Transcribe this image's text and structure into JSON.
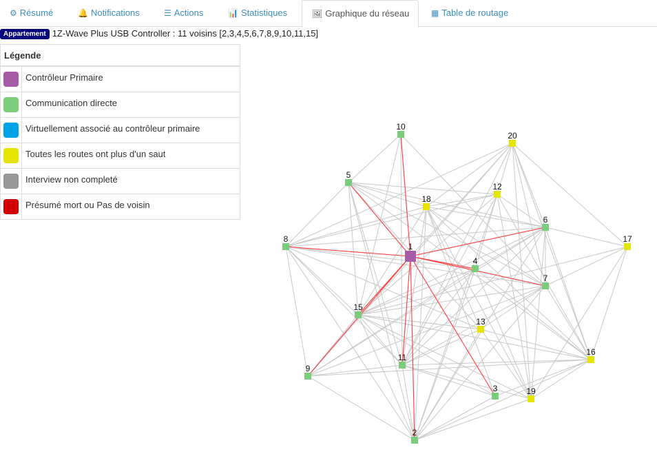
{
  "tabs": [
    {
      "label": "Résumé",
      "icon": "dashboard-icon",
      "glyph": "⚙"
    },
    {
      "label": "Notifications",
      "icon": "bell-icon",
      "glyph": "🔔"
    },
    {
      "label": "Actions",
      "icon": "sliders-icon",
      "glyph": "☰"
    },
    {
      "label": "Statistiques",
      "icon": "bar-chart-icon",
      "glyph": "📊"
    },
    {
      "label": "Graphique du réseau",
      "icon": "image-icon",
      "glyph": "🖼",
      "active": true
    },
    {
      "label": "Table de routage",
      "icon": "table-icon",
      "glyph": "▦"
    }
  ],
  "info": {
    "badge": "Appartement",
    "text": "1Z-Wave Plus USB Controller : 11 voisins [2,3,4,5,6,7,8,9,10,11,15]"
  },
  "legend": {
    "title": "Légende",
    "items": [
      {
        "label": "Contrôleur Primaire",
        "color": "#a65ba6"
      },
      {
        "label": "Communication directe",
        "color": "#7bcd7b"
      },
      {
        "label": "Virtuellement associé au contrôleur primaire",
        "color": "#00a2e8"
      },
      {
        "label": "Toutes les routes ont plus d'un saut",
        "color": "#e5e500"
      },
      {
        "label": "Interview non completé",
        "color": "#979797"
      },
      {
        "label": "Présumé mort ou Pas de voisin",
        "color": "#d20000"
      }
    ]
  },
  "graph": {
    "nodes": [
      {
        "id": "1",
        "type": 0
      },
      {
        "id": "2",
        "type": 1
      },
      {
        "id": "3",
        "type": 1
      },
      {
        "id": "4",
        "type": 1
      },
      {
        "id": "5",
        "type": 1
      },
      {
        "id": "6",
        "type": 1
      },
      {
        "id": "7",
        "type": 1
      },
      {
        "id": "8",
        "type": 1
      },
      {
        "id": "9",
        "type": 1
      },
      {
        "id": "10",
        "type": 1
      },
      {
        "id": "11",
        "type": 1
      },
      {
        "id": "12",
        "type": 3
      },
      {
        "id": "13",
        "type": 3
      },
      {
        "id": "15",
        "type": 1
      },
      {
        "id": "16",
        "type": 3
      },
      {
        "id": "17",
        "type": 3
      },
      {
        "id": "18",
        "type": 3
      },
      {
        "id": "19",
        "type": 3
      },
      {
        "id": "20",
        "type": 3
      }
    ],
    "controller_links": [
      "2",
      "3",
      "4",
      "5",
      "6",
      "7",
      "8",
      "9",
      "10",
      "11",
      "15"
    ],
    "links": [
      [
        "10",
        "5"
      ],
      [
        "10",
        "15"
      ],
      [
        "10",
        "7"
      ],
      [
        "10",
        "11"
      ],
      [
        "5",
        "8"
      ],
      [
        "5",
        "18"
      ],
      [
        "5",
        "12"
      ],
      [
        "5",
        "6"
      ],
      [
        "5",
        "7"
      ],
      [
        "5",
        "15"
      ],
      [
        "5",
        "11"
      ],
      [
        "5",
        "2"
      ],
      [
        "5",
        "16"
      ],
      [
        "5",
        "13"
      ],
      [
        "8",
        "18"
      ],
      [
        "8",
        "12"
      ],
      [
        "8",
        "20"
      ],
      [
        "8",
        "6"
      ],
      [
        "8",
        "7"
      ],
      [
        "8",
        "4"
      ],
      [
        "8",
        "15"
      ],
      [
        "8",
        "9"
      ],
      [
        "8",
        "11"
      ],
      [
        "8",
        "2"
      ],
      [
        "8",
        "13"
      ],
      [
        "18",
        "20"
      ],
      [
        "18",
        "6"
      ],
      [
        "18",
        "7"
      ],
      [
        "18",
        "16"
      ],
      [
        "18",
        "19"
      ],
      [
        "18",
        "13"
      ],
      [
        "18",
        "15"
      ],
      [
        "18",
        "11"
      ],
      [
        "18",
        "2"
      ],
      [
        "18",
        "3"
      ],
      [
        "18",
        "12"
      ],
      [
        "12",
        "15"
      ],
      [
        "12",
        "11"
      ],
      [
        "12",
        "16"
      ],
      [
        "12",
        "19"
      ],
      [
        "12",
        "2"
      ],
      [
        "12",
        "6"
      ],
      [
        "20",
        "15"
      ],
      [
        "20",
        "11"
      ],
      [
        "20",
        "6"
      ],
      [
        "20",
        "7"
      ],
      [
        "20",
        "16"
      ],
      [
        "20",
        "17"
      ],
      [
        "20",
        "19"
      ],
      [
        "20",
        "9"
      ],
      [
        "20",
        "4"
      ],
      [
        "6",
        "15"
      ],
      [
        "6",
        "11"
      ],
      [
        "6",
        "9"
      ],
      [
        "6",
        "16"
      ],
      [
        "6",
        "19"
      ],
      [
        "6",
        "7"
      ],
      [
        "6",
        "17"
      ],
      [
        "6",
        "2"
      ],
      [
        "6",
        "4"
      ],
      [
        "17",
        "7"
      ],
      [
        "17",
        "19"
      ],
      [
        "17",
        "16"
      ],
      [
        "17",
        "15"
      ],
      [
        "4",
        "15"
      ],
      [
        "4",
        "16"
      ],
      [
        "4",
        "11"
      ],
      [
        "4",
        "2"
      ],
      [
        "4",
        "9"
      ],
      [
        "4",
        "19"
      ],
      [
        "7",
        "15"
      ],
      [
        "7",
        "11"
      ],
      [
        "7",
        "9"
      ],
      [
        "7",
        "16"
      ],
      [
        "7",
        "2"
      ],
      [
        "7",
        "13"
      ],
      [
        "15",
        "13"
      ],
      [
        "15",
        "16"
      ],
      [
        "15",
        "3"
      ],
      [
        "15",
        "19"
      ],
      [
        "15",
        "2"
      ],
      [
        "15",
        "9"
      ],
      [
        "15",
        "11"
      ],
      [
        "13",
        "11"
      ],
      [
        "13",
        "16"
      ],
      [
        "13",
        "2"
      ],
      [
        "13",
        "19"
      ],
      [
        "11",
        "16"
      ],
      [
        "11",
        "3"
      ],
      [
        "11",
        "2"
      ],
      [
        "11",
        "9"
      ],
      [
        "11",
        "19"
      ],
      [
        "9",
        "2"
      ],
      [
        "9",
        "16"
      ],
      [
        "3",
        "2"
      ],
      [
        "3",
        "16"
      ],
      [
        "19",
        "16"
      ],
      [
        "2",
        "16"
      ],
      [
        "2",
        "19"
      ]
    ],
    "link_color": "#c8c8c8",
    "controller_link_color": "#ff3b3b"
  }
}
